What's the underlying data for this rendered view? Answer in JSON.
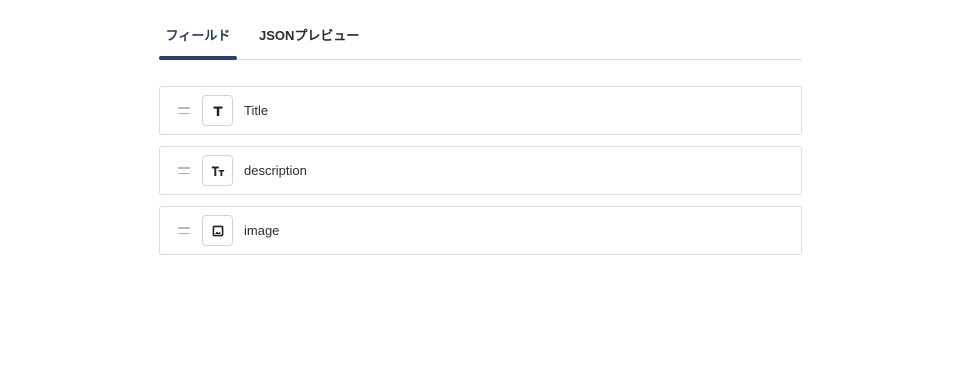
{
  "tabs": {
    "fields_label": "フィールド",
    "json_preview_label": "JSONプレビュー",
    "active": "fields"
  },
  "fields": [
    {
      "name": "Title",
      "icon": "text-icon"
    },
    {
      "name": "description",
      "icon": "rich-text-icon"
    },
    {
      "name": "image",
      "icon": "image-icon"
    }
  ],
  "colors": {
    "active_tab": "#2e3f64",
    "border": "#dcdcdc",
    "handle": "#b5b5b5"
  }
}
